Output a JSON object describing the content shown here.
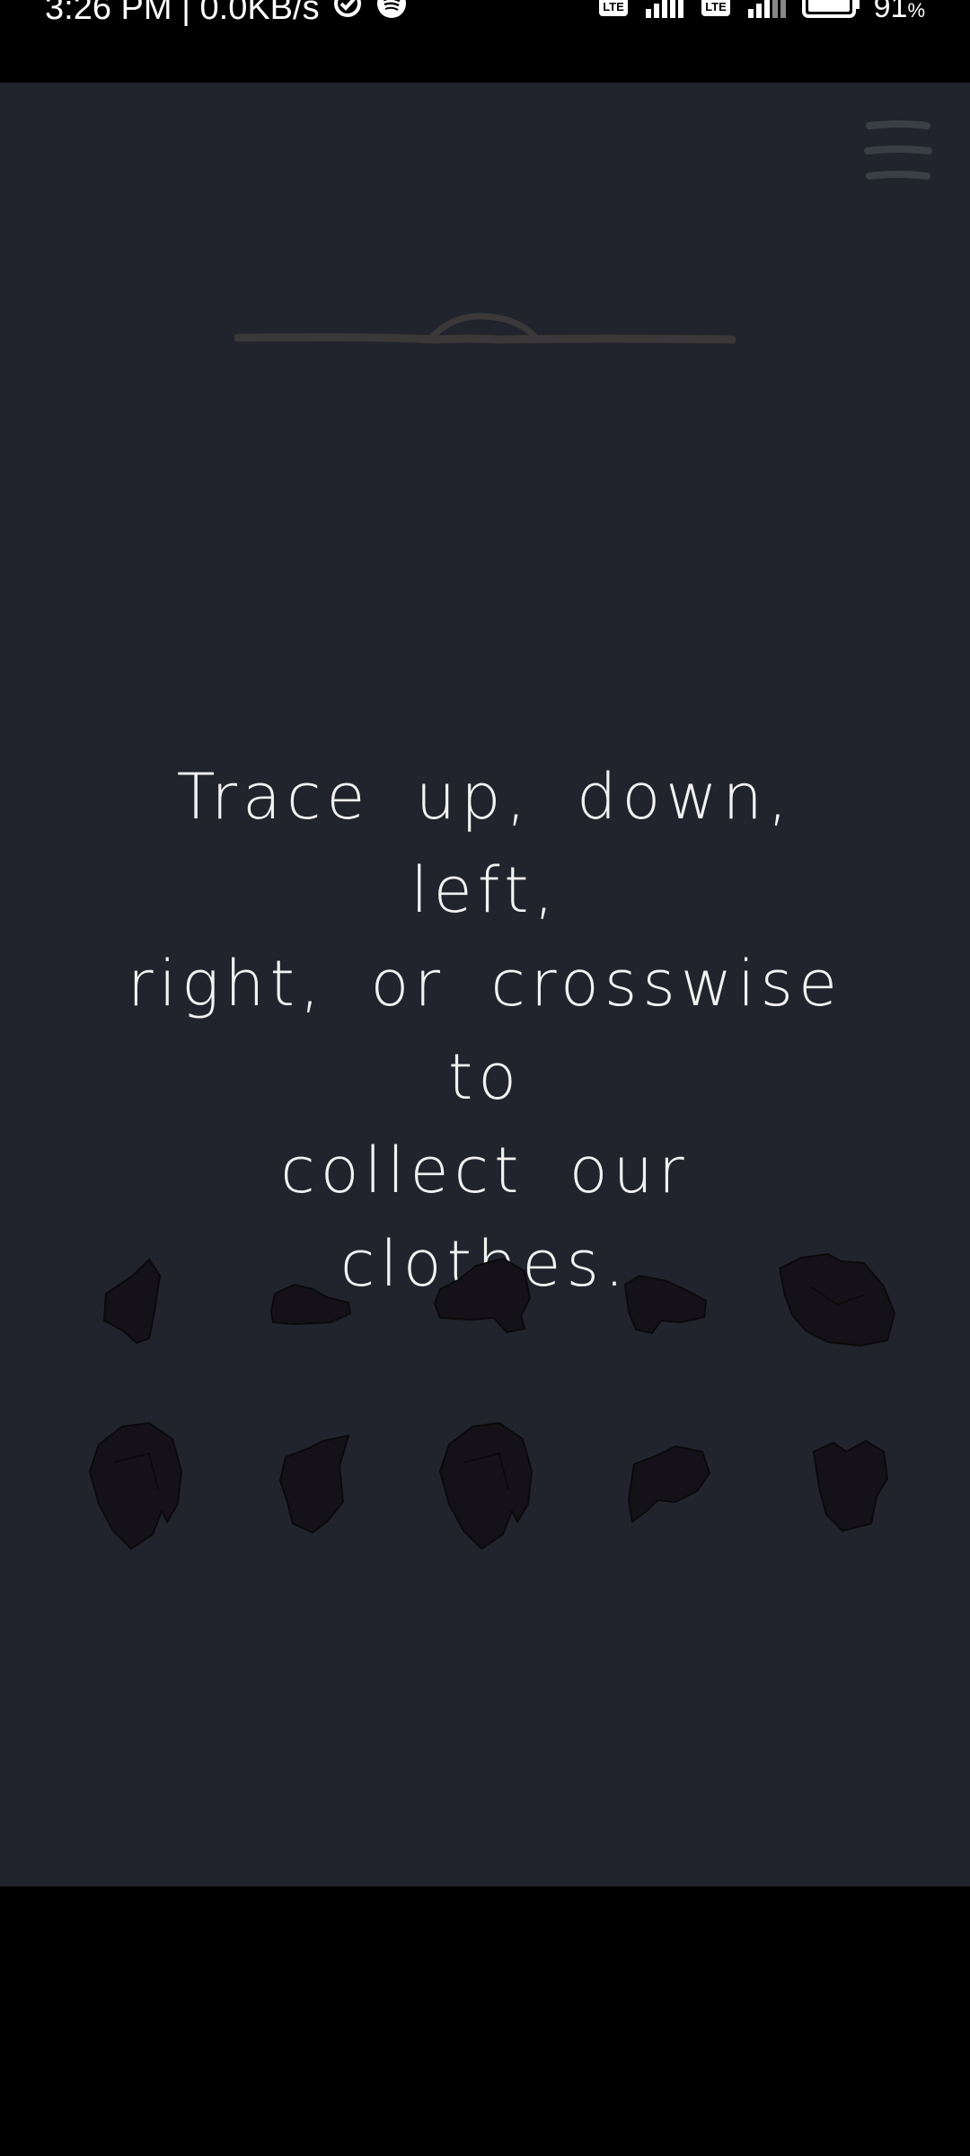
{
  "status_bar": {
    "time_speed": "3:26 PM | 0.0KB/s",
    "battery": "91",
    "battery_unit": "%"
  },
  "game": {
    "instruction_line1": "Trace up, down, left,",
    "instruction_line2": "right, or crosswise to",
    "instruction_line3": "collect our clothes.",
    "clothes_rows": 2,
    "clothes_per_row": 5
  },
  "colors": {
    "background": "#21242c",
    "text": "#f2f2f2",
    "clothing_fill": "#141218",
    "hanger": "#3a3a3a",
    "menu": "#3a3e45"
  }
}
